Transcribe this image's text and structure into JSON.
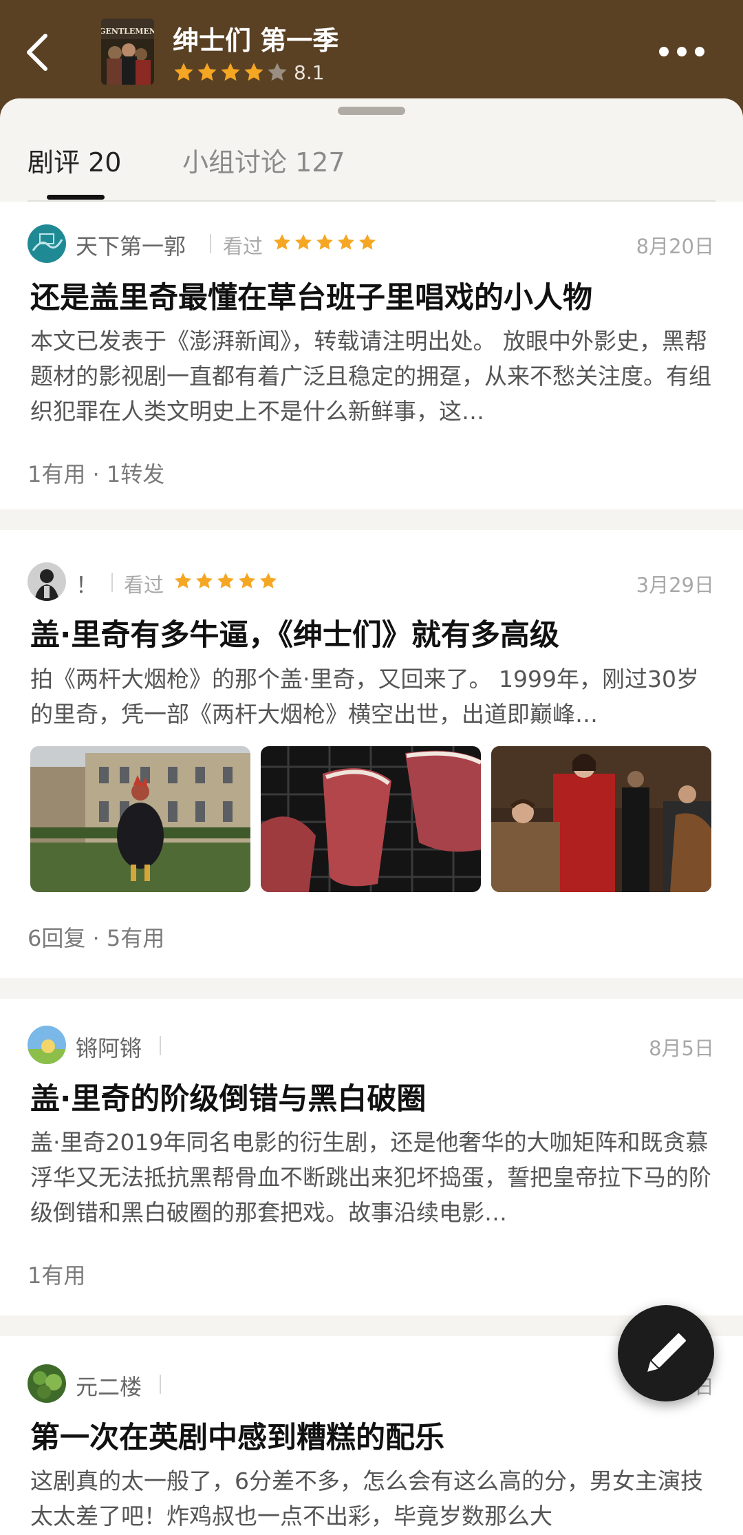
{
  "header": {
    "title": "绅士们 第一季",
    "rating": 8.1,
    "rating_text": "8.1",
    "star_count": 4,
    "poster_text": "GENTLEMEN",
    "colors": {
      "background": "#5a4124",
      "star": "#f5a623"
    }
  },
  "tabs": [
    {
      "label": "剧评 20",
      "active": true
    },
    {
      "label": "小组讨论 127",
      "active": false
    }
  ],
  "reviews": [
    {
      "author": "天下第一郭",
      "status": "看过",
      "stars": 5,
      "date": "8月20日",
      "title": "还是盖里奇最懂在草台班子里唱戏的小人物",
      "excerpt": "本文已发表于《澎湃新闻》，转载请注明出处。 放眼中外影史，黑帮题材的影视剧一直都有着广泛且稳定的拥趸，从来不愁关注度。有组织犯罪在人类文明史上不是什么新鲜事，这…",
      "stats": "1有用 · 1转发"
    },
    {
      "author": "！",
      "status": "看过",
      "stars": 5,
      "date": "3月29日",
      "title": "盖·里奇有多牛逼，《绅士们》就有多高级",
      "excerpt": "拍《两杆大烟枪》的那个盖·里奇，又回来了。 1999年，刚过30岁的里奇，凭一部《两杆大烟枪》横空出世，出道即巅峰…",
      "stats": "6回复 · 5有用",
      "images": [
        "rooster-costume-photo",
        "steak-grill-photo",
        "cast-group-photo"
      ]
    },
    {
      "author": "锵阿锵",
      "date": "8月5日",
      "title": "盖·里奇的阶级倒错与黑白破圈",
      "excerpt": "盖·里奇2019年同名电影的衍生剧，还是他奢华的大咖矩阵和既贪慕浮华又无法抵抗黑帮骨血不断跳出来犯坏捣蛋，誓把皇帝拉下马的阶级倒错和黑白破圈的那套把戏。故事沿续电影…",
      "stats": "1有用"
    },
    {
      "author": "元二楼",
      "date": "日",
      "title": "第一次在英剧中感到糟糕的配乐",
      "excerpt": "这剧真的太一般了，6分差不多，怎么会有这么高的分，男女主演技太太差了吧！炸鸡叔也一点不出彩，毕竟岁数那么大"
    }
  ],
  "fab": {
    "icon": "pencil-icon"
  }
}
